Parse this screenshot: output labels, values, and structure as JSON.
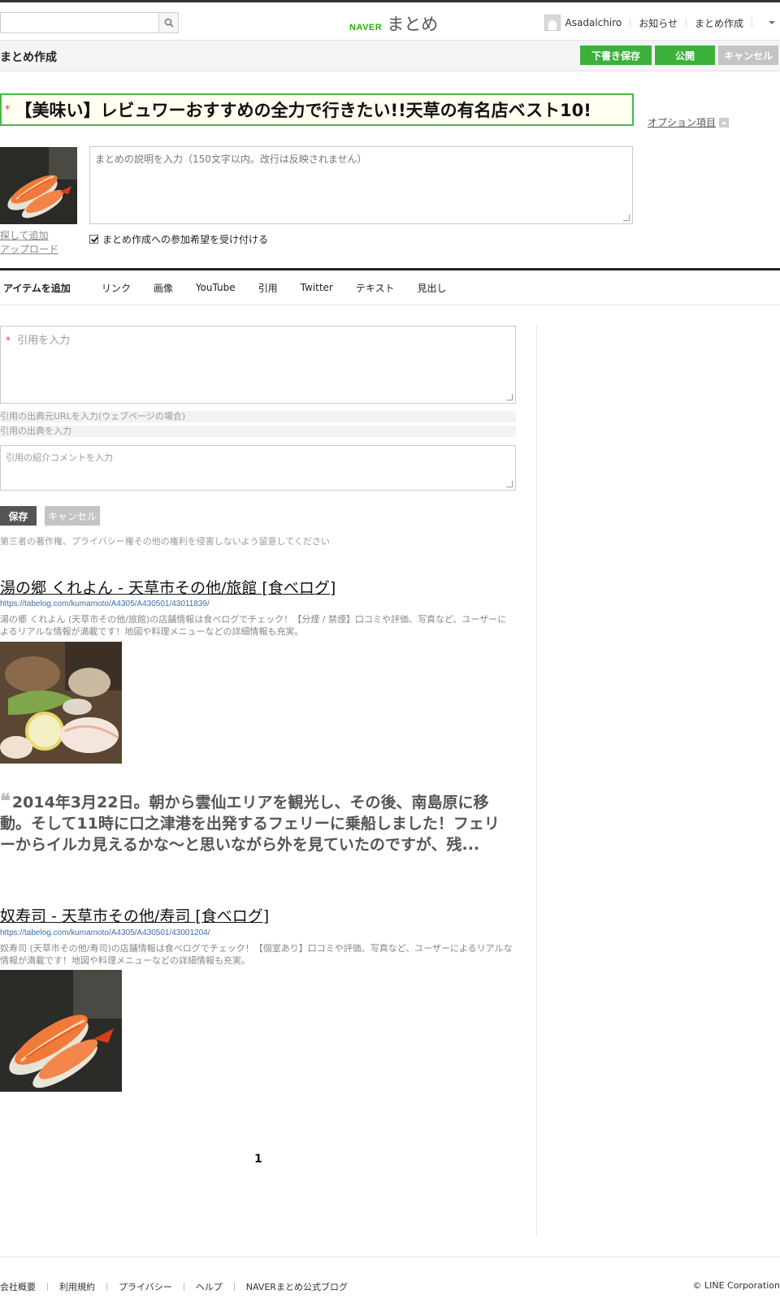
{
  "header": {
    "search": {
      "placeholder": ""
    },
    "logo": {
      "brand": "NAVER",
      "product": "まとめ"
    },
    "user": {
      "name": "Asadalchiro"
    },
    "nav": {
      "notices": "お知らせ",
      "create": "まとめ作成"
    }
  },
  "subheader": {
    "title": "まとめ作成",
    "draft_label": "下書き保存",
    "publish_label": "公開",
    "cancel_label": "キャンセル"
  },
  "editor": {
    "required_mark": "*",
    "title_value": "【美味い】レビュワーおすすめの全力で行きたい!!天草の有名店ベスト10!",
    "options_label": "オプション項目",
    "description_placeholder": "まとめの説明を入力（150文字以内。改行は反映されません）",
    "thumb_search": "探して追加",
    "thumb_upload": "アップロード",
    "participation_label": "まとめ作成への参加希望を受け付ける"
  },
  "toolbar": {
    "lead": "アイテムを追加",
    "items": [
      "リンク",
      "画像",
      "YouTube",
      "引用",
      "Twitter",
      "テキスト",
      "見出し"
    ]
  },
  "quote_form": {
    "quote_placeholder": "引用を入力",
    "source_url_placeholder": "引用の出典元URLを入力(ウェブページの場合)",
    "source_placeholder": "引用の出典を入力",
    "comment_placeholder": "引用の紹介コメントを入力",
    "save_label": "保存",
    "cancel_label": "キャンセル",
    "notice": "第三者の著作権、プライバシー権その他の権利を侵害しないよう留意してください"
  },
  "items": [
    {
      "title": "湯の郷 くれよん - 天草市その他/旅館 [食べログ]",
      "url": "https://tabelog.com/kumamoto/A4305/A430501/43011839/",
      "desc": "湯の郷 くれよん (天草市その他/旅館)の店舗情報は食べログでチェック！【分煙 / 禁煙】口コミや評価、写真など、ユーザーによるリアルな情報が満載です！地図や料理メニューなどの詳細情報も充実。"
    },
    {
      "quote_mark": "❝",
      "quote": "2014年3月22日。朝から雲仙エリアを観光し、その後、南島原に移動。そして11時に口之津港を出発するフェリーに乗船しました！フェリーからイルカ見えるかな〜と思いながら外を見ていたのですが、残..."
    },
    {
      "title": "奴寿司 - 天草市その他/寿司 [食べログ]",
      "url": "https://tabelog.com/kumamoto/A4305/A430501/43001204/",
      "desc": "奴寿司 (天草市その他/寿司)の店舗情報は食べログでチェック！【個室あり】口コミや評価、写真など、ユーザーによるリアルな情報が満載です！地図や料理メニューなどの詳細情報も充実。"
    }
  ],
  "pagination": {
    "current": "1"
  },
  "footer": {
    "links": [
      "会社概要",
      "利用規約",
      "プライバシー",
      "ヘルプ",
      "NAVERまとめ公式ブログ"
    ],
    "copyright": "© LINE Corporation"
  },
  "colors": {
    "accent_green": "#3bb13b",
    "title_border": "#48b848",
    "link_blue": "#3b6fb0",
    "required_red": "#ee3333"
  }
}
